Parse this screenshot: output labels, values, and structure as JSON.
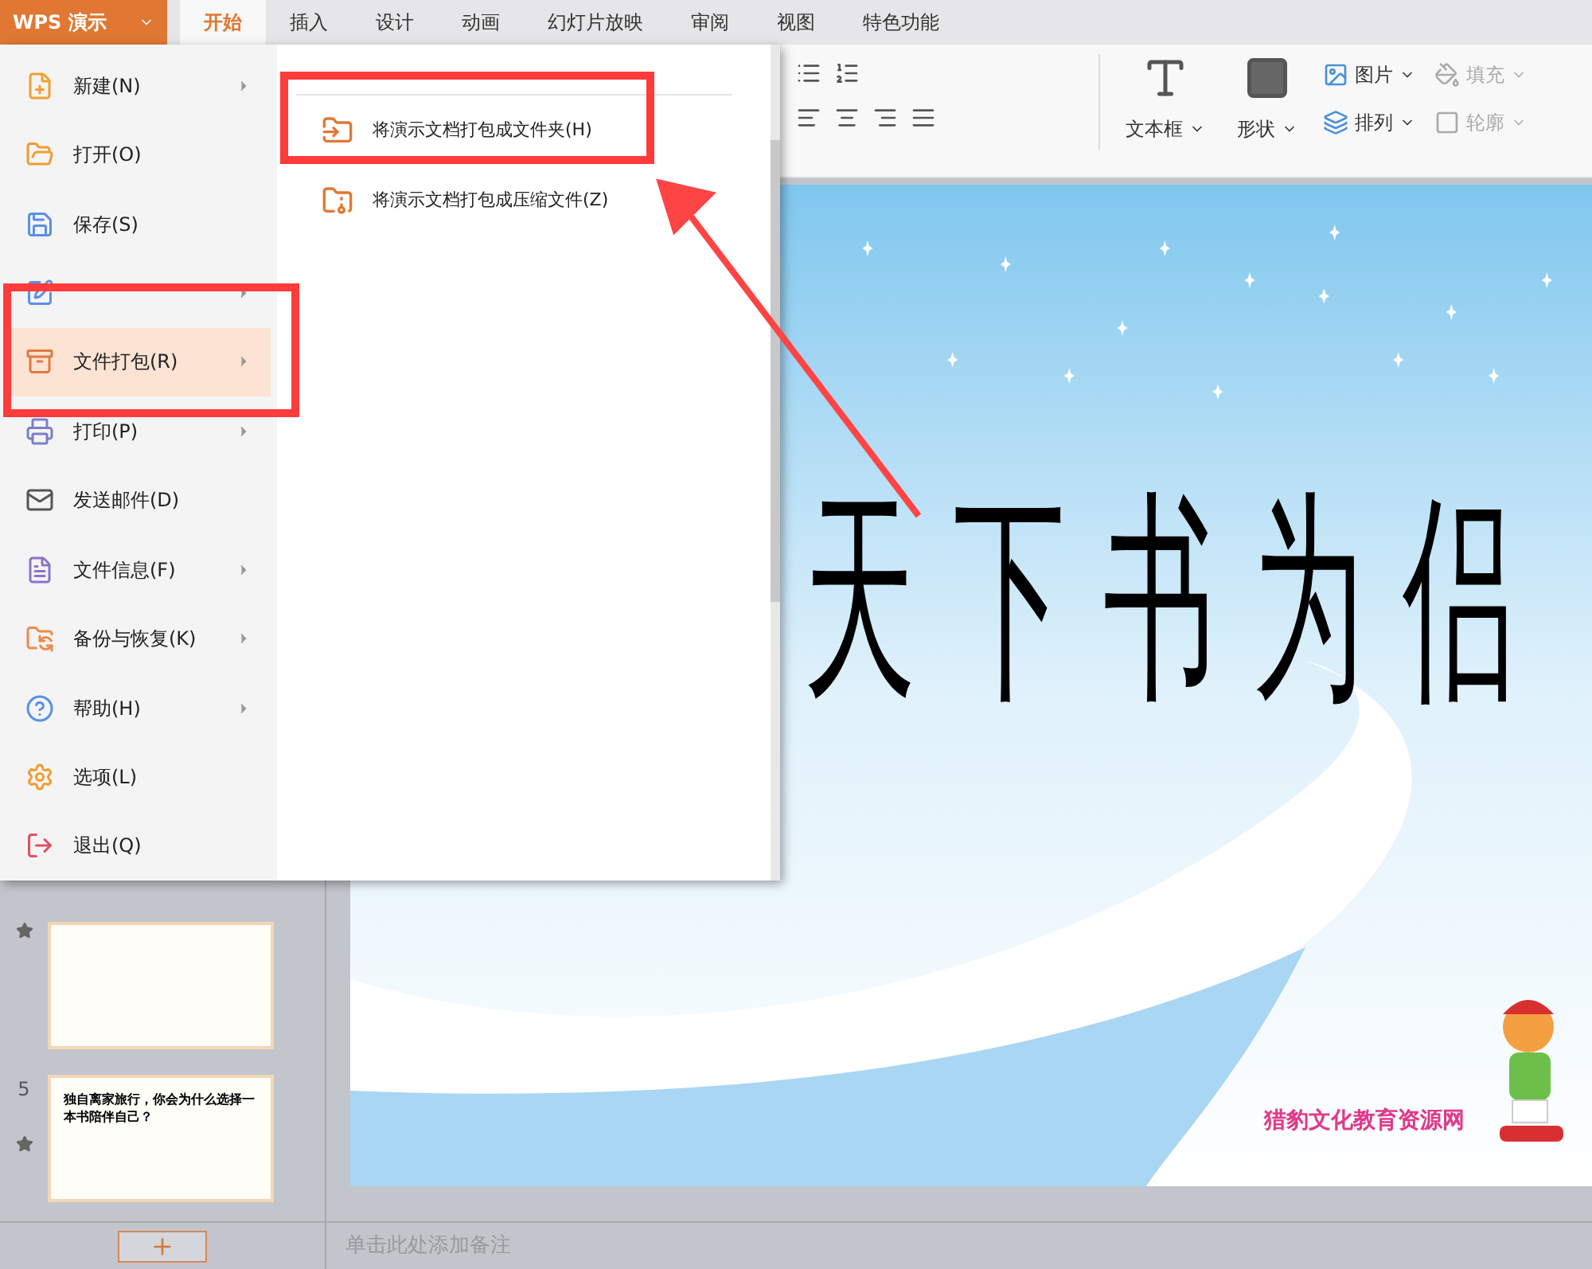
{
  "app_button": {
    "label": "WPS 演示"
  },
  "tabs": [
    {
      "label": "开始",
      "selected": true
    },
    {
      "label": "插入",
      "selected": false
    },
    {
      "label": "设计",
      "selected": false
    },
    {
      "label": "动画",
      "selected": false
    },
    {
      "label": "幻灯片放映",
      "selected": false
    },
    {
      "label": "审阅",
      "selected": false
    },
    {
      "label": "视图",
      "selected": false
    },
    {
      "label": "特色功能",
      "selected": false
    }
  ],
  "ribbon_tools": [
    {
      "label": "文本框",
      "disabled": false
    },
    {
      "label": "形状",
      "disabled": false
    }
  ],
  "ribbon_small_tools": [
    {
      "label": "图片",
      "disabled": false
    },
    {
      "label": "填充",
      "disabled": true
    },
    {
      "label": "排列",
      "disabled": false
    },
    {
      "label": "轮廓",
      "disabled": true
    }
  ],
  "file_menu": {
    "items": [
      {
        "label": "新建(N)",
        "submenu": true,
        "selected": false
      },
      {
        "label": "打开(O)",
        "submenu": false,
        "selected": false
      },
      {
        "label": "保存(S)",
        "submenu": false,
        "selected": false
      },
      {
        "submenu": true,
        "selected": false
      },
      {
        "label": "文件打包(R)",
        "submenu": true,
        "selected": true
      },
      {
        "label": "打印(P)",
        "submenu": true,
        "selected": false
      },
      {
        "label": "发送邮件(D)",
        "submenu": false,
        "selected": false
      },
      {
        "label": "文件信息(F)",
        "submenu": true,
        "selected": false
      },
      {
        "label": "备份与恢复(K)",
        "submenu": true,
        "selected": false
      },
      {
        "label": "帮助(H)",
        "submenu": true,
        "selected": false
      },
      {
        "label": "选项(L)",
        "submenu": false,
        "selected": false
      },
      {
        "label": "退出(Q)",
        "submenu": false,
        "selected": false
      }
    ],
    "submenu": {
      "items": [
        {
          "label": "将演示文档打包成文件夹(H)"
        },
        {
          "label": "将演示文档打包成压缩文件(Z)"
        }
      ]
    }
  },
  "slides_panel": {
    "slides": [
      {
        "starred": true
      },
      {
        "number": "5",
        "starred": true,
        "text": "独自离家旅行，你会为什么选择一本书陪伴自己？"
      }
    ]
  },
  "slide": {
    "title": "天下书为侣",
    "site_name": "猎豹文化教育资源网"
  },
  "notes": {
    "placeholder": "单击此处添加备注"
  }
}
